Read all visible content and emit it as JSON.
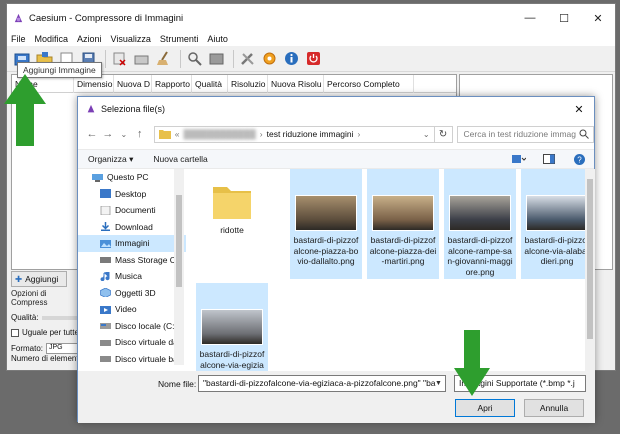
{
  "app": {
    "title": "Caesium - Compressore di Immagini",
    "menu": [
      "File",
      "Modifica",
      "Azioni",
      "Visualizza",
      "Strumenti",
      "Aiuto"
    ],
    "tooltip": "Aggiungi Immagine",
    "columns": [
      "Nome",
      "Dimensio",
      "Nuova D",
      "Rapporto",
      "Qualità",
      "Risoluzio",
      "Nuova Risolu",
      "Percorso Completo"
    ],
    "add_button": "Aggiungi",
    "options_title": "Opzioni di Compress",
    "quality_label": "Qualità:",
    "same_for_all": "Uguale per tutte",
    "format_label": "Formato:",
    "format_value": "JPG",
    "item_count": "Numero di elementi"
  },
  "dialog": {
    "title": "Seleziona file(s)",
    "path_current": "test riduzione immagini",
    "search_placeholder": "Cerca in test riduzione immag",
    "organize": "Organizza ▾",
    "new_folder": "Nuova cartella",
    "nav": [
      {
        "label": "Questo PC",
        "selected": false
      },
      {
        "label": "Desktop",
        "selected": false
      },
      {
        "label": "Documenti",
        "selected": false
      },
      {
        "label": "Download",
        "selected": false
      },
      {
        "label": "Immagini",
        "selected": true
      },
      {
        "label": "Mass Storage Co",
        "selected": false
      },
      {
        "label": "Musica",
        "selected": false
      },
      {
        "label": "Oggetti 3D",
        "selected": false
      },
      {
        "label": "Video",
        "selected": false
      },
      {
        "label": "Disco locale (C:)",
        "selected": false
      },
      {
        "label": "Disco virtuale da",
        "selected": false
      },
      {
        "label": "Disco virtuale ba",
        "selected": false
      }
    ],
    "files": [
      {
        "label": "ridotte",
        "type": "folder",
        "selected": false
      },
      {
        "label": "bastardi-di-pizzofalcone-piazza-bovio-dallalto.png",
        "type": "image",
        "selected": true
      },
      {
        "label": "bastardi-di-pizzofalcone-piazza-dei-martiri.png",
        "type": "image",
        "selected": true
      },
      {
        "label": "bastardi-di-pizzofalcone-rampe-san-giovanni-maggiore.png",
        "type": "image",
        "selected": true
      },
      {
        "label": "bastardi-di-pizzofalcone-via-alabardieri.png",
        "type": "image",
        "selected": true
      },
      {
        "label": "bastardi-di-pizzofalcone-via-egiziaca-a-pizzofalcone.png",
        "type": "image",
        "selected": true
      }
    ],
    "filename_label": "Nome file:",
    "filename_value": "\"bastardi-di-pizzofalcone-via-egiziaca-a-pizzofalcone.png\" \"ba",
    "filter_value": "Immagini Supportate (*.bmp *.j",
    "open_button": "Apri",
    "cancel_button": "Annulla"
  },
  "colors": {
    "selection": "#cce8ff",
    "arrow_green": "#2e9e2e",
    "accent": "#0078d7"
  }
}
